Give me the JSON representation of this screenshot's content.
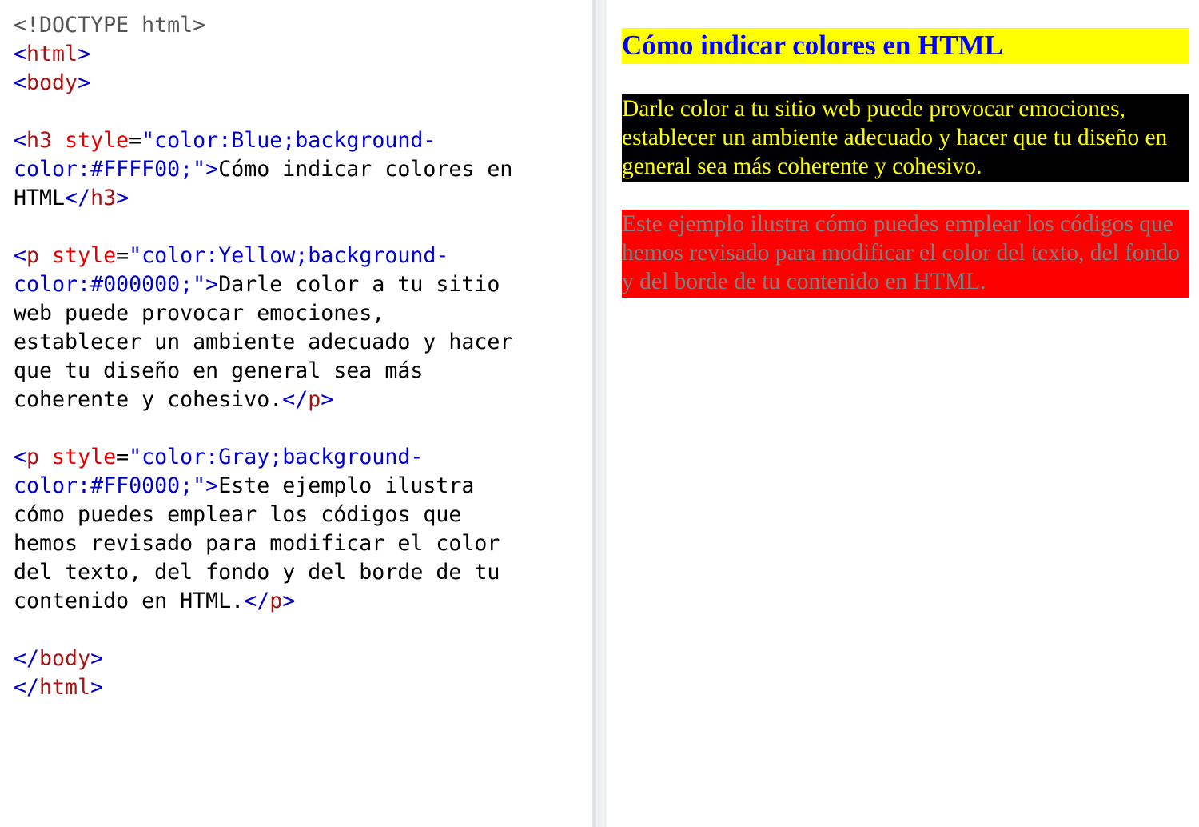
{
  "editor": {
    "lines": [
      [
        {
          "t": "doctype",
          "v": "<!DOCTYPE html>"
        }
      ],
      [
        {
          "t": "bracket",
          "v": "<"
        },
        {
          "t": "tag",
          "v": "html"
        },
        {
          "t": "bracket",
          "v": ">"
        }
      ],
      [
        {
          "t": "bracket",
          "v": "<"
        },
        {
          "t": "tag",
          "v": "body"
        },
        {
          "t": "bracket",
          "v": ">"
        }
      ],
      [],
      [
        {
          "t": "bracket",
          "v": "<"
        },
        {
          "t": "tag",
          "v": "h3 "
        },
        {
          "t": "attr",
          "v": "style"
        },
        {
          "t": "eq",
          "v": "="
        },
        {
          "t": "value",
          "v": "\"color:Blue;background-"
        }
      ],
      [
        {
          "t": "value",
          "v": "color:#FFFF00;\""
        },
        {
          "t": "bracket",
          "v": ">"
        },
        {
          "t": "text",
          "v": "Cómo indicar colores en"
        }
      ],
      [
        {
          "t": "text",
          "v": "HTML"
        },
        {
          "t": "bracket",
          "v": "</"
        },
        {
          "t": "tag",
          "v": "h3"
        },
        {
          "t": "bracket",
          "v": ">"
        }
      ],
      [],
      [
        {
          "t": "bracket",
          "v": "<"
        },
        {
          "t": "tag",
          "v": "p "
        },
        {
          "t": "attr",
          "v": "style"
        },
        {
          "t": "eq",
          "v": "="
        },
        {
          "t": "value",
          "v": "\"color:Yellow;background-"
        }
      ],
      [
        {
          "t": "value",
          "v": "color:#000000;\""
        },
        {
          "t": "bracket",
          "v": ">"
        },
        {
          "t": "text",
          "v": "Darle color a tu sitio"
        }
      ],
      [
        {
          "t": "text",
          "v": "web puede provocar emociones,"
        }
      ],
      [
        {
          "t": "text",
          "v": "establecer un ambiente adecuado y hacer"
        }
      ],
      [
        {
          "t": "text",
          "v": "que tu diseño en general sea más"
        }
      ],
      [
        {
          "t": "text",
          "v": "coherente y cohesivo."
        },
        {
          "t": "bracket",
          "v": "</"
        },
        {
          "t": "tag",
          "v": "p"
        },
        {
          "t": "bracket",
          "v": ">"
        }
      ],
      [],
      [
        {
          "t": "bracket",
          "v": "<"
        },
        {
          "t": "tag",
          "v": "p "
        },
        {
          "t": "attr",
          "v": "style"
        },
        {
          "t": "eq",
          "v": "="
        },
        {
          "t": "value",
          "v": "\"color:Gray;background-"
        }
      ],
      [
        {
          "t": "value",
          "v": "color:#FF0000;\""
        },
        {
          "t": "bracket",
          "v": ">"
        },
        {
          "t": "text",
          "v": "Este ejemplo ilustra"
        }
      ],
      [
        {
          "t": "text",
          "v": "cómo puedes emplear los códigos que"
        }
      ],
      [
        {
          "t": "text",
          "v": "hemos revisado para modificar el color"
        }
      ],
      [
        {
          "t": "text",
          "v": "del texto, del fondo y del borde de tu"
        }
      ],
      [
        {
          "t": "text",
          "v": "contenido en HTML."
        },
        {
          "t": "bracket",
          "v": "</"
        },
        {
          "t": "tag",
          "v": "p"
        },
        {
          "t": "bracket",
          "v": ">"
        }
      ],
      [],
      [
        {
          "t": "bracket",
          "v": "</"
        },
        {
          "t": "tag",
          "v": "body"
        },
        {
          "t": "bracket",
          "v": ">"
        }
      ],
      [
        {
          "t": "bracket",
          "v": "</"
        },
        {
          "t": "tag",
          "v": "html"
        },
        {
          "t": "bracket",
          "v": ">"
        }
      ]
    ],
    "colors": {
      "doctype": "#555555",
      "bracket": "#0000cc",
      "tag": "#a31515",
      "attr": "#e50000",
      "value": "#0000cc",
      "text": "#000000"
    }
  },
  "preview": {
    "heading": {
      "text": "Cómo indicar colores en HTML",
      "color": "#0000ff",
      "background": "#ffff00"
    },
    "paragraph1": {
      "text": "Darle color a tu sitio web puede provocar emociones, establecer un ambiente adecuado y hacer que tu diseño en general sea más coherente y cohesivo.",
      "color": "#ffff00",
      "background": "#000000"
    },
    "paragraph2": {
      "text": "Este ejemplo ilustra cómo puedes emplear los códigos que hemos revisado para modificar el color del texto, del fondo y del borde de tu contenido en HTML.",
      "color": "#808080",
      "background": "#ff0000"
    }
  }
}
